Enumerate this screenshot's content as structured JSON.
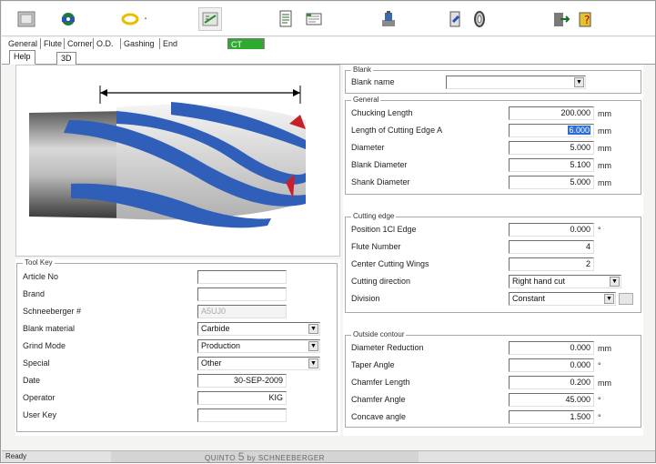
{
  "toolbar": {
    "icons": [
      "window-icon",
      "tool-library-icon",
      "rotate-icon",
      "measure-icon",
      "document-icon",
      "grinder-icon",
      "pick-tool-icon",
      "wheel-icon",
      "exit-icon",
      "help-icon"
    ]
  },
  "tabs": [
    "General",
    "Flute",
    "Corner",
    "O.D.",
    "Gashing",
    "End",
    "CT",
    ""
  ],
  "subtabs": [
    "Help",
    "3D"
  ],
  "blank": {
    "title": "Blank",
    "blank_name_label": "Blank name",
    "blank_name_value": ""
  },
  "general": {
    "title": "General",
    "rows": [
      {
        "label": "Chucking Length",
        "value": "200.000",
        "unit": "mm"
      },
      {
        "label": "Length of Cutting Edge A",
        "value": "6.000",
        "unit": "mm"
      },
      {
        "label": "Diameter",
        "value": "5.000",
        "unit": "mm"
      },
      {
        "label": "Blank Diameter",
        "value": "5.100",
        "unit": "mm"
      },
      {
        "label": "Shank Diameter",
        "value": "5.000",
        "unit": "mm"
      }
    ]
  },
  "cutting_edge": {
    "title": "Cutting edge",
    "rows": [
      {
        "label": "Position 1Cl Edge",
        "value": "0.000",
        "unit": "°"
      },
      {
        "label": "Flute Number",
        "value": "4",
        "unit": ""
      },
      {
        "label": "Center Cutting Wings",
        "value": "2",
        "unit": ""
      }
    ],
    "cutting_direction_label": "Cutting direction",
    "cutting_direction_value": "Right hand cut",
    "division_label": "Division",
    "division_value": "Constant"
  },
  "outside_contour": {
    "title": "Outside contour",
    "rows": [
      {
        "label": "Diameter Reduction",
        "value": "0.000",
        "unit": "mm"
      },
      {
        "label": "Taper Angle",
        "value": "0.000",
        "unit": "°"
      },
      {
        "label": "Chamfer Length",
        "value": "0.200",
        "unit": "mm"
      },
      {
        "label": "Chamfer Angle",
        "value": "45.000",
        "unit": "°"
      },
      {
        "label": "Concave angle",
        "value": "1.500",
        "unit": "°"
      }
    ]
  },
  "tool_key": {
    "title": "Tool Key",
    "article_no_label": "Article No",
    "article_no_value": "",
    "brand_label": "Brand",
    "brand_value": "",
    "schneeberger_label": "Schneeberger #",
    "schneeberger_value": "A5UJ0",
    "blank_material_label": "Blank material",
    "blank_material_value": "Carbide",
    "grind_mode_label": "Grind Mode",
    "grind_mode_value": "Production",
    "special_label": "Special",
    "special_value": "Other",
    "date_label": "Date",
    "date_value": "30-SEP-2009",
    "operator_label": "Operator",
    "operator_value": "KIG",
    "user_key_label": "User Key",
    "user_key_value": ""
  },
  "status": {
    "ready": "Ready",
    "brand_prefix": "QUINTO",
    "brand_num": "5",
    "brand_suffix": "by SCHNEEBERGER"
  },
  "colors": {
    "active_tab": "#2eaa2e",
    "flute_blue": "#2f5fb8",
    "cutting_red": "#c8202a",
    "selection": "#2b6fd6"
  }
}
